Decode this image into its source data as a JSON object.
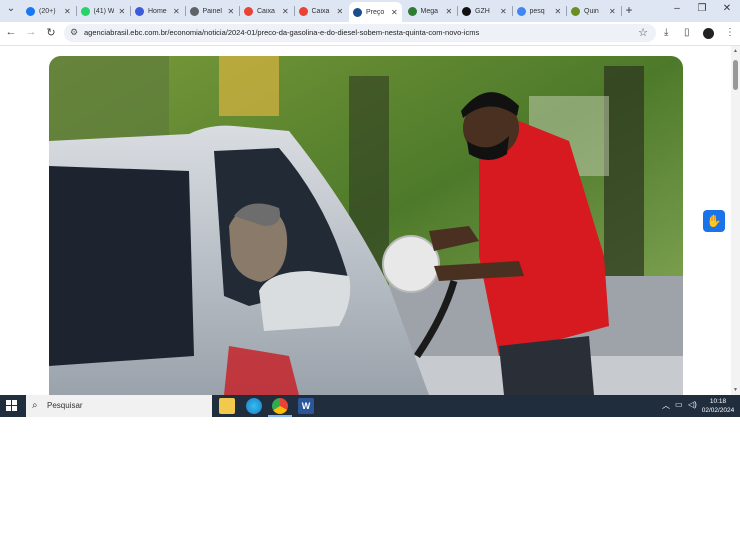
{
  "browser": {
    "tabs": [
      {
        "label": "(20+)",
        "icon": "facebook-icon",
        "color": "#1877f2"
      },
      {
        "label": "(41) W",
        "icon": "whatsapp-icon",
        "color": "#25d366"
      },
      {
        "label": "Home",
        "icon": "home-site-icon",
        "color": "#3b5bdb"
      },
      {
        "label": "Painel",
        "icon": "globe-icon",
        "color": "#5f6368"
      },
      {
        "label": "Caixa",
        "icon": "gmail-icon",
        "color": "#ea4335"
      },
      {
        "label": "Caixa",
        "icon": "gmail-icon",
        "color": "#ea4335"
      },
      {
        "label": "Preço",
        "icon": "agencia-brasil-icon",
        "color": "#1a4d8f",
        "active": true
      },
      {
        "label": "Mega",
        "icon": "mega-icon",
        "color": "#2e7d32"
      },
      {
        "label": "GZH",
        "icon": "gzh-icon",
        "color": "#111111"
      },
      {
        "label": "pesq",
        "icon": "google-icon",
        "color": "#4285f4"
      },
      {
        "label": "Quin",
        "icon": "quina-icon",
        "color": "#6b8e23"
      }
    ],
    "url": "agenciabrasil.ebc.com.br/economia/noticia/2024-01/preco-da-gasolina-e-do-diesel-sobem-nesta-quinta-com-novo-icms"
  },
  "taskbar": {
    "search_placeholder": "Pesquisar",
    "time": "10:18",
    "date": "02/02/2024"
  },
  "colors": {
    "accent": "#1a73e8",
    "tabbar": "#dfe6f3",
    "taskbar": "#1f2d3d",
    "uniform": "#d71920"
  }
}
